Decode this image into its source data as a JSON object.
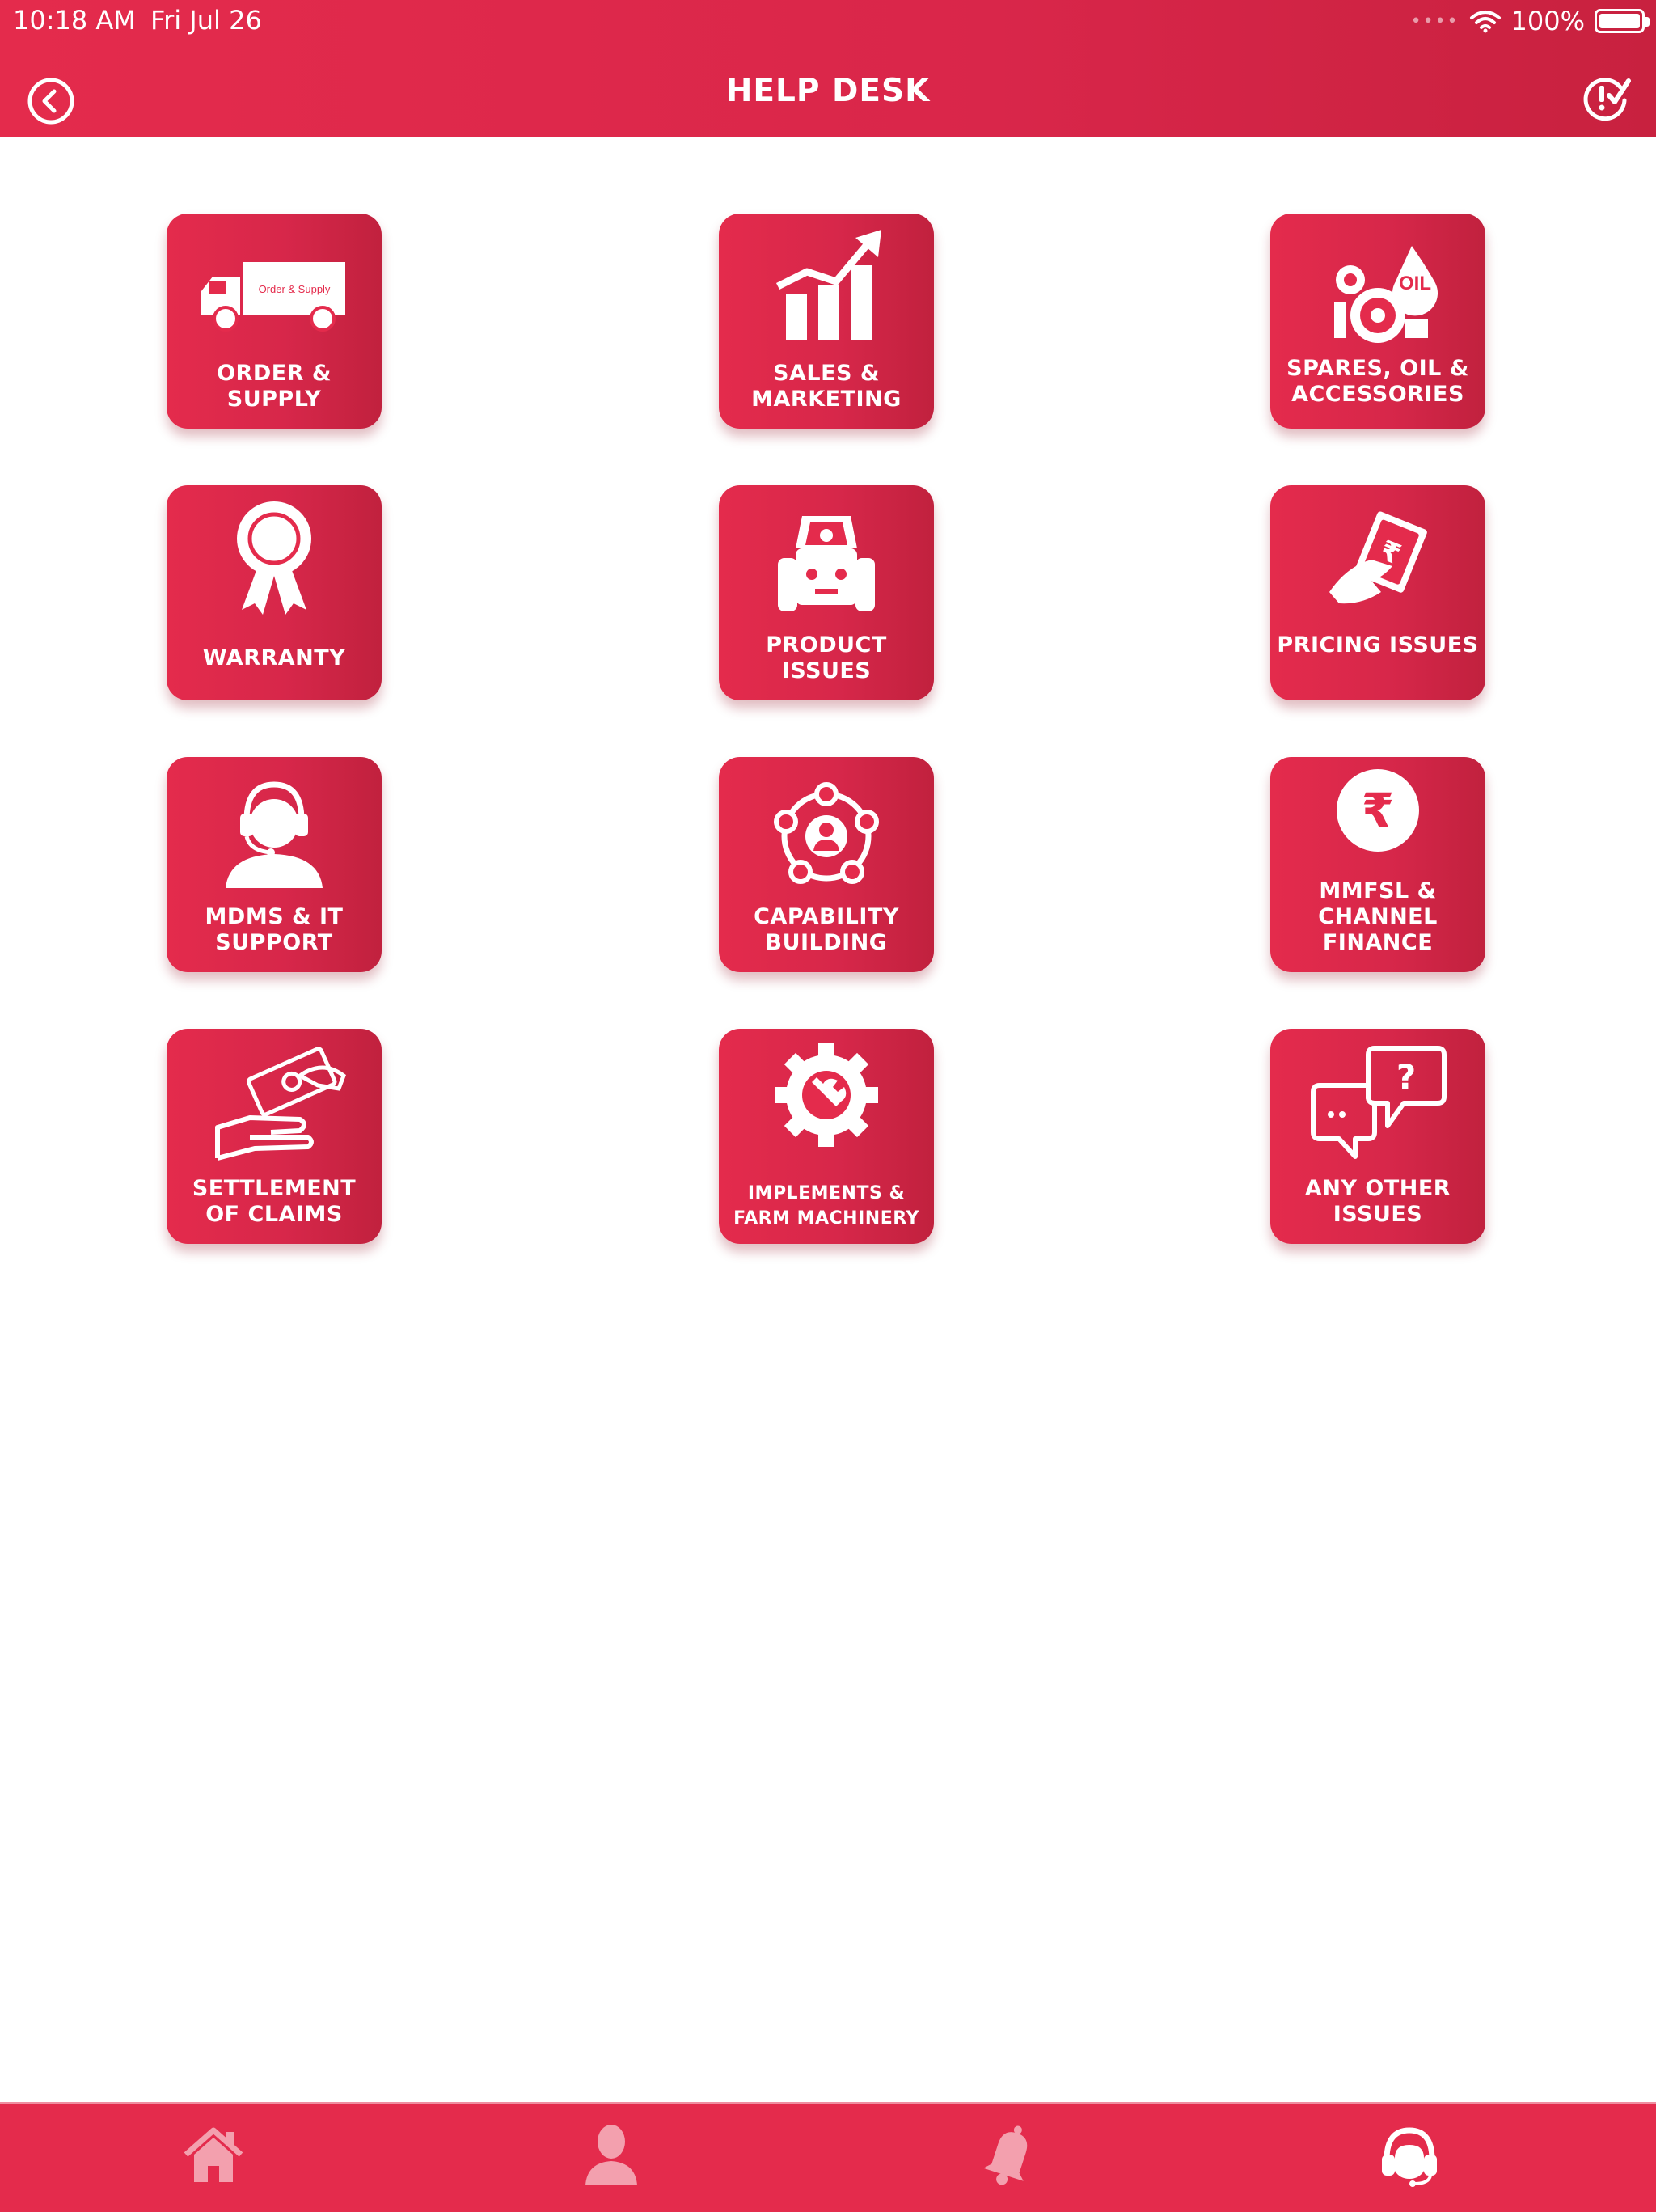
{
  "status_bar": {
    "time": "10:18 AM",
    "date": "Fri Jul 26",
    "battery": "100%",
    "battery_level": 1.0
  },
  "header": {
    "title": "HELP DESK",
    "back_icon": "back-arrow-circle-icon",
    "status_icon": "ticket-status-icon"
  },
  "tiles": [
    {
      "label": "ORDER & SUPPLY",
      "icon": "delivery-truck-icon",
      "truck_text": "Order & Supply"
    },
    {
      "label": "SALES & MARKETING",
      "icon": "growth-chart-icon"
    },
    {
      "label": "SPARES, OIL & ACCESSORIES",
      "icon": "spares-oil-icon",
      "oil_text": "OIL"
    },
    {
      "label": "WARRANTY",
      "icon": "award-ribbon-icon"
    },
    {
      "label": "PRODUCT ISSUES",
      "icon": "tractor-icon"
    },
    {
      "label": "PRICING ISSUES",
      "icon": "cash-in-hand-icon",
      "currency": "₹"
    },
    {
      "label": "MDMS & IT SUPPORT",
      "icon": "support-agent-icon"
    },
    {
      "label": "CAPABILITY BUILDING",
      "icon": "network-people-icon"
    },
    {
      "label": "MMFSL & CHANNEL FINANCE",
      "icon": "rupee-coin-icon",
      "currency": "₹"
    },
    {
      "label": "SETTLEMENT OF CLAIMS",
      "icon": "hand-money-icon"
    },
    {
      "label": "IMPLEMENTS & FARM MACHINERY",
      "icon": "gear-wrench-icon"
    },
    {
      "label": "ANY OTHER ISSUES",
      "icon": "chat-question-icon",
      "question_mark": "?"
    }
  ],
  "bottom_nav": [
    {
      "name": "home",
      "icon": "home-icon"
    },
    {
      "name": "profile",
      "icon": "user-icon"
    },
    {
      "name": "notifications",
      "icon": "bell-icon"
    },
    {
      "name": "help-desk",
      "icon": "headset-icon",
      "active": true
    }
  ],
  "colors": {
    "primary": "#e42b4c",
    "primary_dark": "#c1213e",
    "inactive_tab_icon": "#f3a0ae",
    "active_tab_icon": "#ffffff"
  }
}
